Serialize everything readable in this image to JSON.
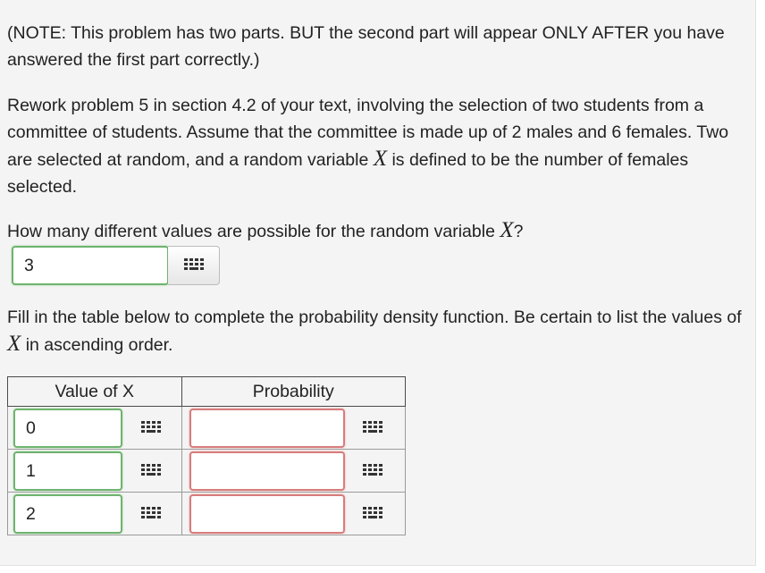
{
  "note": "(NOTE: This problem has two parts. BUT the second part will appear ONLY AFTER you have answered the first part correctly.)",
  "problem": {
    "before": "Rework problem 5 in section 4.2 of your text, involving the selection of two students from a committee of students. Assume that the committee is made up of 2 males and 6 females. Two are selected at random, and a random variable ",
    "var": "X",
    "after": " is defined to be the number of females selected."
  },
  "question": {
    "before": "How many different values are possible for the random variable ",
    "var": "X",
    "after": "?"
  },
  "count_answer": {
    "value": "3",
    "status": "correct"
  },
  "instructions": {
    "before": "Fill in the table below to complete the probability density function. Be certain to list the values of ",
    "var": "X",
    "after": " in ascending order."
  },
  "table": {
    "headers": [
      "Value of X",
      "Probability"
    ],
    "rows": [
      {
        "value": "0",
        "probability": ""
      },
      {
        "value": "1",
        "probability": ""
      },
      {
        "value": "2",
        "probability": ""
      }
    ]
  },
  "icons": {
    "keyboard": "keyboard-grid-icon"
  },
  "colors": {
    "correct_border": "#6fb36f",
    "incorrect_border": "#d77c7c",
    "panel_bg": "#f4f4f4"
  }
}
